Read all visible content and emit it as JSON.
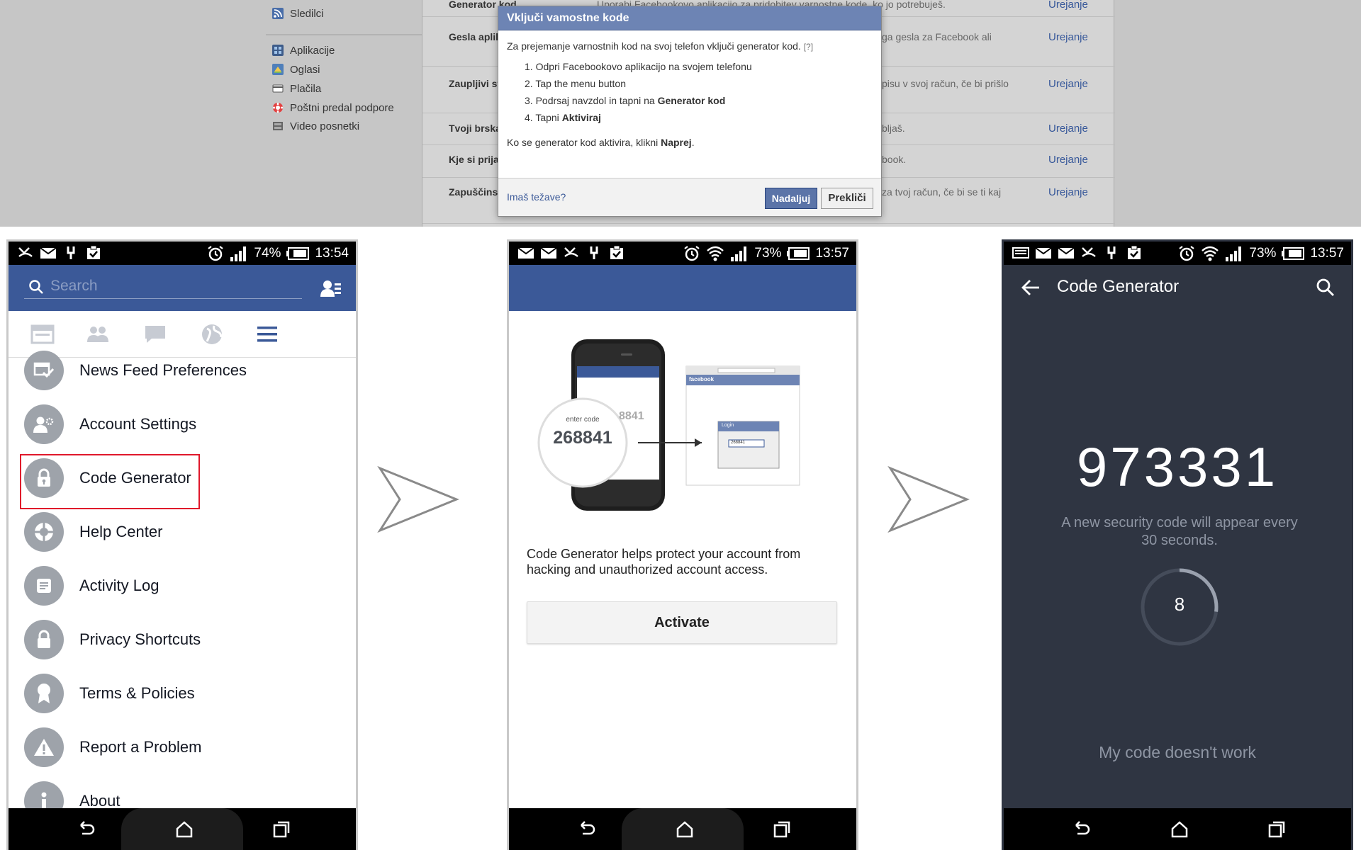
{
  "desktop": {
    "sidebar": [
      {
        "label": "Sledilci",
        "icon": "rss-icon"
      },
      {
        "label": "Aplikacije",
        "icon": "apps-icon"
      },
      {
        "label": "Oglasi",
        "icon": "ads-icon"
      },
      {
        "label": "Plačila",
        "icon": "card-icon"
      },
      {
        "label": "Poštni predal podpore",
        "icon": "lifebuoy-icon"
      },
      {
        "label": "Video posnetki",
        "icon": "film-icon"
      }
    ],
    "rows": [
      {
        "label": "Generator kod",
        "text": "Uporabi Facebookovo aplikacijo za pridobitev varnostne kode, ko jo potrebuješ.",
        "edit": "Urejanje"
      },
      {
        "label": "Gesla aplik",
        "text": "ga gesla za Facebook ali",
        "edit": "Urejanje"
      },
      {
        "label": "Zaupljivi st",
        "text": "pisu v svoj račun, če bi prišlo",
        "edit": "Urejanje"
      },
      {
        "label": "Tvoji brska",
        "text": "bljaš.",
        "edit": "Urejanje"
      },
      {
        "label": "Kje si prija",
        "text": "book.",
        "edit": "Urejanje"
      },
      {
        "label": "Zapuščinsl",
        "text": "za tvoj račun, če bi se ti kaj",
        "edit": "Urejanje"
      }
    ],
    "dialog": {
      "title": "Vključi vamostne kode",
      "intro": "Za prejemanje varnostnih kod na svoj telefon vključi generator kod.",
      "help": "[?]",
      "steps": [
        {
          "num": "1.",
          "text": "Odpri Facebookovo aplikacijo na svojem telefonu",
          "bold": ""
        },
        {
          "num": "2.",
          "text": "Tap the menu button",
          "bold": ""
        },
        {
          "num": "3.",
          "text": "Podrsaj navzdol in tapni na ",
          "bold": "Generator kod"
        },
        {
          "num": "4.",
          "text": "Tapni ",
          "bold": "Aktiviraj"
        }
      ],
      "after_text": "Ko se generator kod aktivira, klikni ",
      "after_bold": "Naprej",
      "after_end": ".",
      "trouble": "Imaš težave?",
      "next": "Nadaljuj",
      "cancel": "Prekliči"
    }
  },
  "phone1": {
    "battery": "74%",
    "time": "13:54",
    "search_placeholder": "Search",
    "menu": [
      {
        "label": "News Feed Preferences",
        "icon": "news-feed-icon"
      },
      {
        "label": "Account Settings",
        "icon": "account-settings-icon"
      },
      {
        "label": "Code Generator",
        "icon": "lock-icon",
        "highlighted": true
      },
      {
        "label": "Help Center",
        "icon": "lifebuoy-icon"
      },
      {
        "label": "Activity Log",
        "icon": "list-icon"
      },
      {
        "label": "Privacy Shortcuts",
        "icon": "lock-icon"
      },
      {
        "label": "Terms & Policies",
        "icon": "ribbon-icon"
      },
      {
        "label": "Report a Problem",
        "icon": "warning-icon"
      },
      {
        "label": "About",
        "icon": "info-icon"
      }
    ]
  },
  "phone2": {
    "battery": "73%",
    "time": "13:57",
    "illustration": {
      "enter_code": "enter code",
      "code": "268841",
      "partial_code": "8841",
      "site": "facebook",
      "login": "Login",
      "login_value": "268841"
    },
    "description": "Code Generator helps protect your account from hacking and unauthorized account access.",
    "activate": "Activate"
  },
  "phone3": {
    "battery": "73%",
    "time": "13:57",
    "title": "Code Generator",
    "code": "973331",
    "note": "A new security code will appear every 30 seconds.",
    "countdown": "8",
    "countdown_fraction": 0.27,
    "help": "My code doesn't work"
  },
  "colors": {
    "facebook_blue": "#3b5998",
    "dark_panel": "#2f3542",
    "highlight_red": "#e0182b"
  }
}
